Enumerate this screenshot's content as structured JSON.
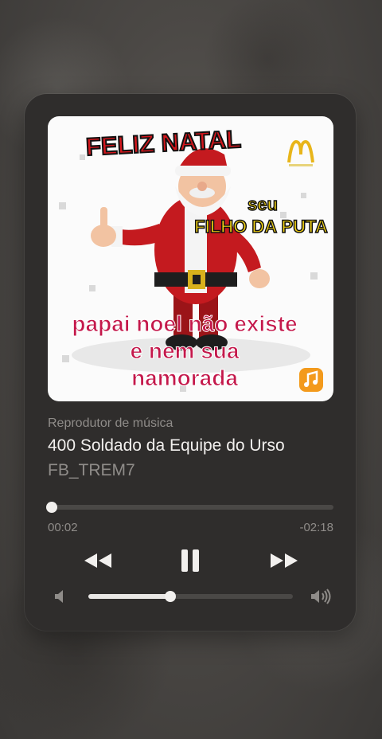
{
  "player": {
    "source_label": "Reprodutor de música",
    "track_title": "400 Soldado da Equipe do Urso",
    "artist": "FB_TREM7",
    "elapsed": "00:02",
    "remaining": "-02:18",
    "progress_fraction": 0.01,
    "volume_fraction": 0.4
  },
  "artwork": {
    "line1": "FELIZ NATAL",
    "side_small": "seu",
    "side_big": "FILHO DA PUTA",
    "bottom1": "papai noel não existe",
    "bottom2": "e nem sua",
    "bottom3": "namorada",
    "logo_icon": "mcdonalds-logo-icon",
    "music_badge_icon": "music-note-icon"
  },
  "icons": {
    "rewind": "rewind-icon",
    "pause": "pause-icon",
    "forward": "fast-forward-icon",
    "volume_low": "speaker-low-icon",
    "volume_high": "speaker-high-icon"
  }
}
